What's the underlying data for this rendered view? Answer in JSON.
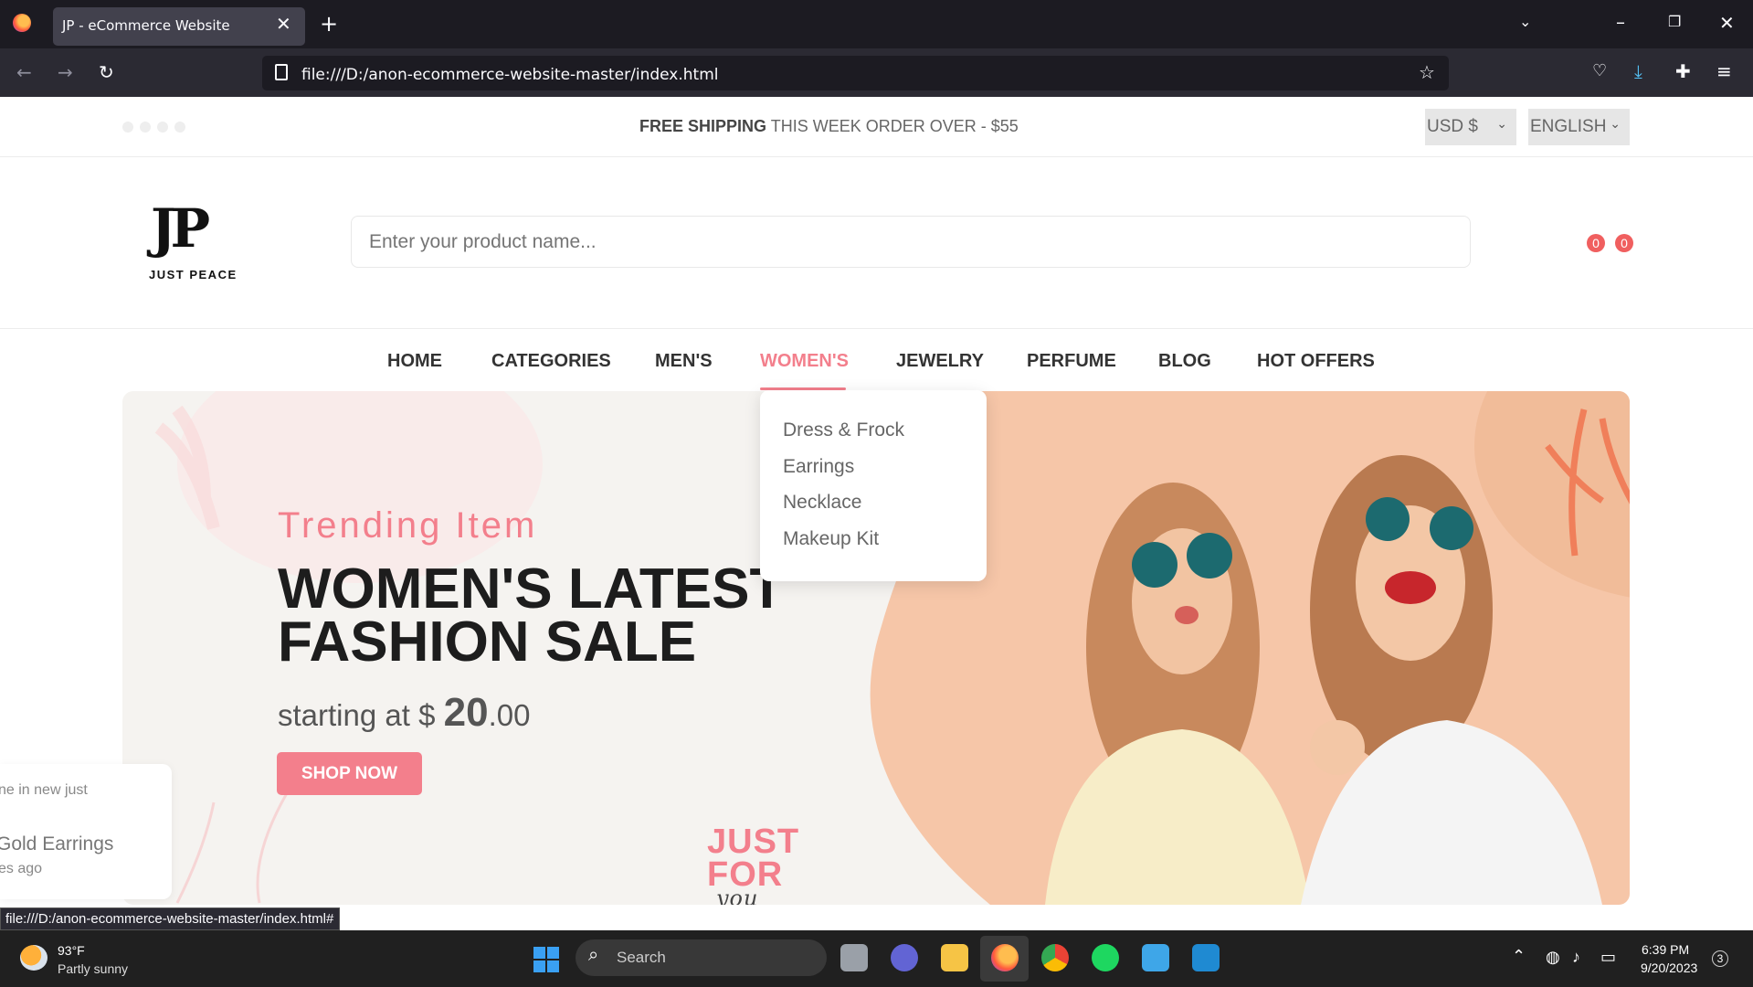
{
  "browser": {
    "tab_title": "JP - eCommerce Website",
    "url": "file:///D:/anon-ecommerce-website-master/index.html",
    "status_url": "file:///D:/anon-ecommerce-website-master/index.html#"
  },
  "topbar": {
    "shipping_bold": "FREE SHIPPING",
    "shipping_rest": " THIS WEEK ORDER OVER - $55",
    "currency": "USD $",
    "language": "ENGLISH"
  },
  "header": {
    "logo_mark": "JP",
    "logo_text": "JUST PEACE",
    "search_placeholder": "Enter your product name...",
    "wishlist_count": "0",
    "cart_count": "0"
  },
  "nav": {
    "items": [
      "HOME",
      "CATEGORIES",
      "MEN'S",
      "WOMEN'S",
      "JEWELRY",
      "PERFUME",
      "BLOG",
      "HOT OFFERS"
    ],
    "active": "WOMEN'S"
  },
  "dropdown": {
    "items": [
      "Dress & Frock",
      "Earrings",
      "Necklace",
      "Makeup Kit"
    ]
  },
  "banner": {
    "subtitle": "Trending Item",
    "title_line1": "WOMEN'S LATEST",
    "title_line2": "FASHION SALE",
    "price_prefix": "starting at $ ",
    "price_whole": "20",
    "price_cents": ".00",
    "button": "SHOP NOW",
    "stamp_line1": "JUST",
    "stamp_line2": "FOR",
    "stamp_line3": "you"
  },
  "toast": {
    "line1": "ne in new just",
    "line2": "Gold Earrings",
    "line3": "es ago"
  },
  "taskbar": {
    "weather_temp": "93°F",
    "weather_desc": "Partly sunny",
    "search_label": "Search",
    "time": "6:39 PM",
    "date": "9/20/2023",
    "notification_count": "3"
  }
}
